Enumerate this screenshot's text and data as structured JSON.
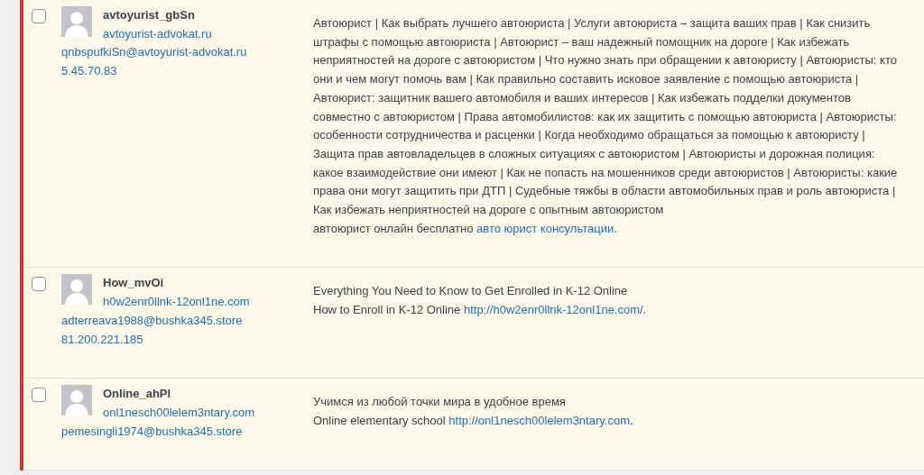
{
  "comments": [
    {
      "selected": false,
      "author": "avtoyurist_gbSn",
      "url": "avtoyurist-advokat.ru",
      "email": "qnbspufkiSn@avtoyurist-advokat.ru",
      "ip": "5.45.70.83",
      "body": [
        {
          "text": "Автоюрист | Как выбрать лучшего автоюриста | Услуги автоюриста – защита ваших прав | Как снизить штрафы с помощью автоюриста | Автоюрист – ваш надежный помощник на дороге | Как избежать неприятностей на дороге с автоюристом | Что нужно знать при обращении к автоюристу | Автоюристы: кто они и чем могут помочь вам | Как правильно составить исковое заявление с помощью автоюриста | Автоюрист: защитник вашего автомобиля и ваших интересов | Как избежать подделки документов совместно с автоюристом | Права автомобилистов: как их защитить с помощью автоюриста | Автоюристы: особенности сотрудничества и расценки | Когда необходимо обращаться за помощью к автоюристу | Защита прав автовладельцев в сложных ситуациях с автоюристом | Автоюристы и дорожная полиция: какое взаимодействие они имеют | Как не попасть на мошенников среди автоюристов | Автоюристы: какие права они могут защитить при ДТП | Судебные тяжбы в области автомобильных прав и роль автоюриста | Как избежать неприятностей на дороге с опытным автоюристом"
        },
        {
          "text": "автоюрист онлайн бесплатно ",
          "link": "авто юрист консультации",
          "after": "."
        }
      ]
    },
    {
      "selected": false,
      "author": "How_mvOi",
      "url": "h0w2enr0llnk-12onl1ne.com",
      "email": "adterreava1988@bushka345.store",
      "ip": "81.200.221.185",
      "body": [
        {
          "text": "Everything You Need to Know to Get Enrolled in K-12 Online"
        },
        {
          "text": "How to Enroll in K-12 Online ",
          "link": "http://h0w2enr0llnk-12onl1ne.com/",
          "after": "."
        }
      ]
    },
    {
      "selected": false,
      "author": "Online_ahPl",
      "url": "onl1nesch00lelem3ntary.com",
      "email": "pemesingli1974@bushka345.store",
      "body": [
        {
          "text": "Учимся из любой точки мира в удобное время"
        },
        {
          "text": "Online elementary school ",
          "link": "http://onl1nesch00lelem3ntary.com",
          "after": "."
        }
      ]
    }
  ]
}
